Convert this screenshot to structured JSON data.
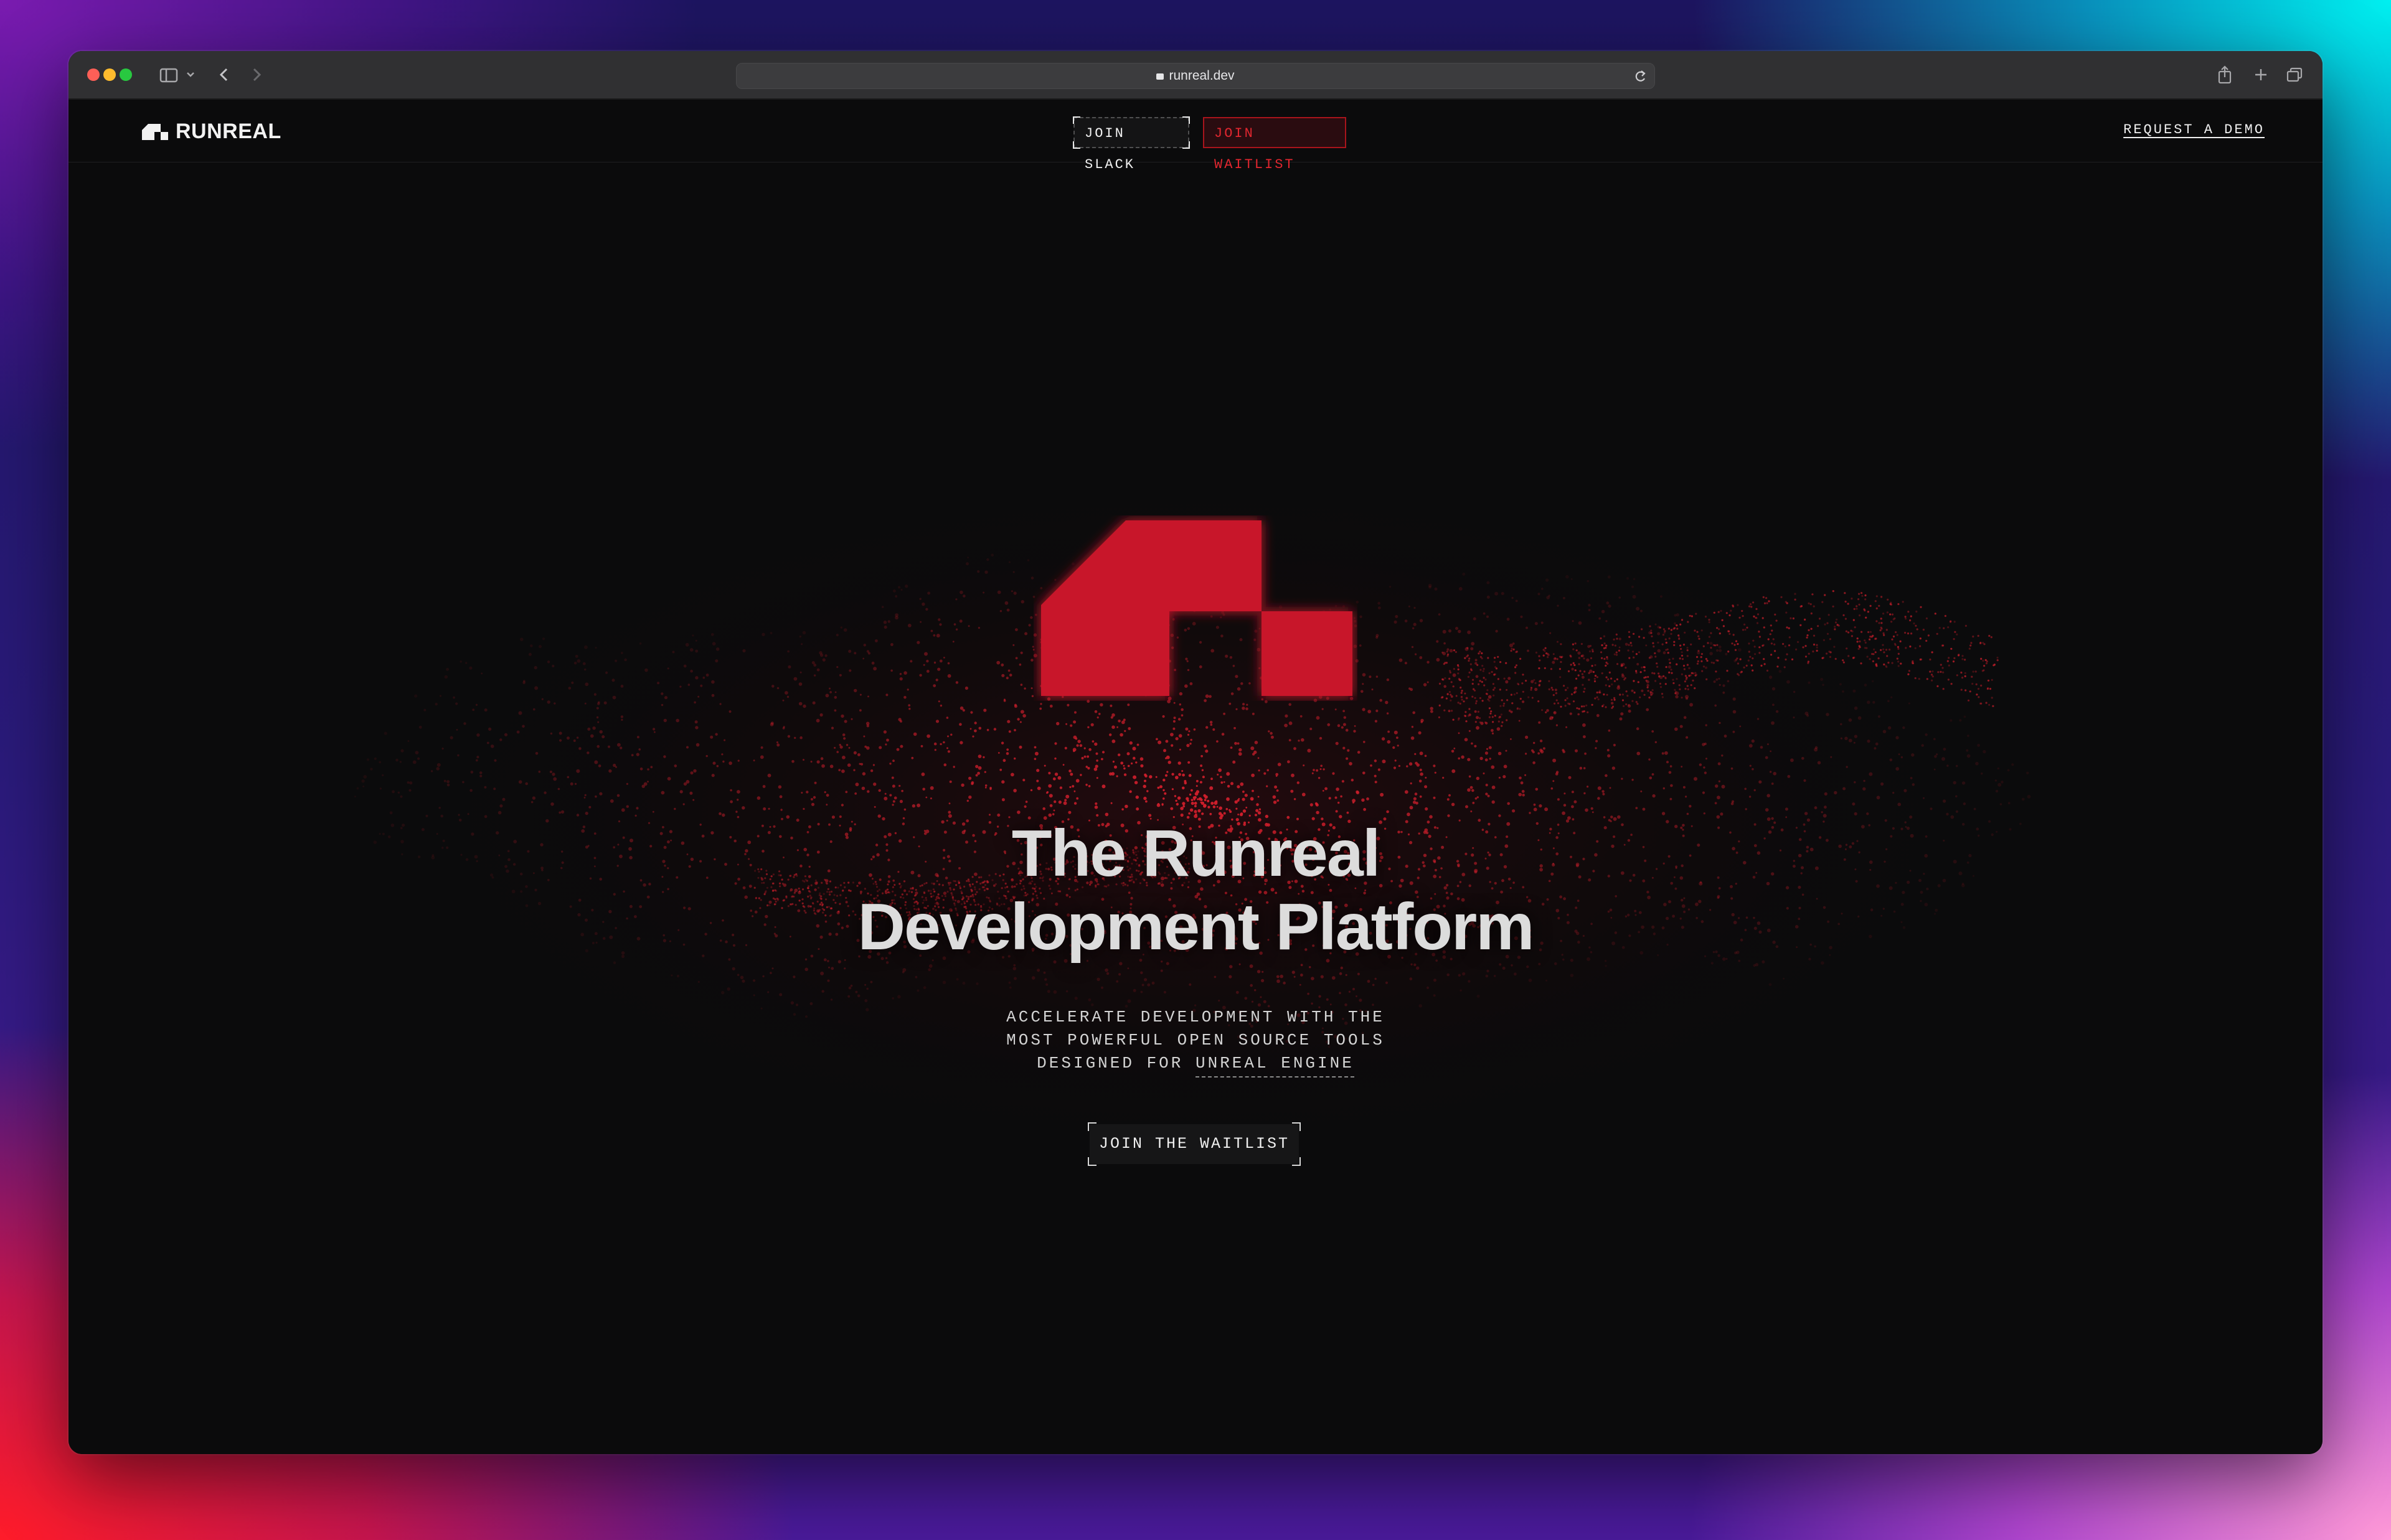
{
  "browser": {
    "url": "runreal.dev"
  },
  "nav": {
    "brand": "RUNREAL",
    "join_slack": "JOIN SLACK",
    "join_waitlist": "JOIN WAITLIST",
    "request_demo": "REQUEST A DEMO"
  },
  "hero": {
    "title_line1": "The Runreal",
    "title_line2": "Development Platform",
    "subtitle_line1": "ACCELERATE DEVELOPMENT WITH THE",
    "subtitle_line2": "MOST POWERFUL OPEN SOURCE TOOLS",
    "subtitle_line3_prefix": "DESIGNED FOR ",
    "subtitle_line3_highlight": "UNREAL ENGINE",
    "cta": "JOIN THE WAITLIST"
  },
  "colors": {
    "brand_red": "#c8162a",
    "page_bg": "#0b0b0c",
    "text": "#dcdcdc"
  },
  "icons": [
    "sidebar-icon",
    "chevron-down-icon",
    "back-icon",
    "forward-icon",
    "lock-icon",
    "reload-icon",
    "share-icon",
    "new-tab-icon",
    "tabs-overview-icon",
    "runreal-logo-icon"
  ]
}
